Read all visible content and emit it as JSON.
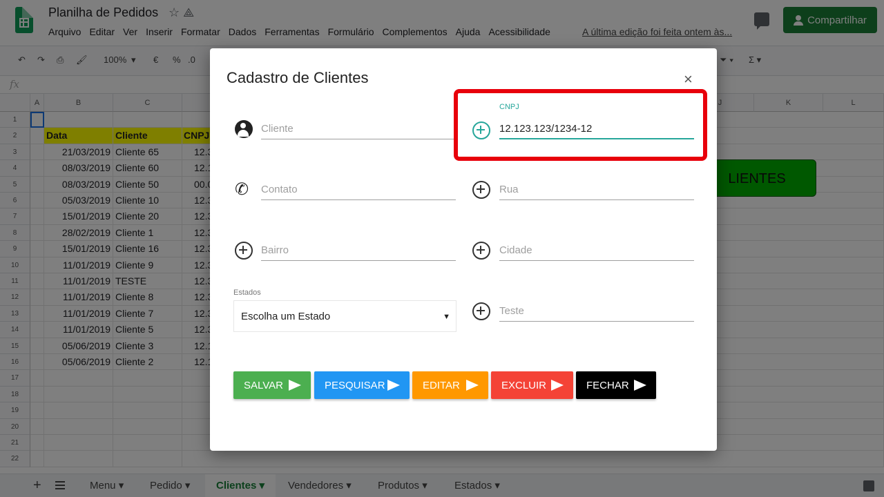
{
  "app": {
    "doc_title": "Planilha de Pedidos",
    "menu": [
      "Arquivo",
      "Editar",
      "Ver",
      "Inserir",
      "Formatar",
      "Dados",
      "Ferramentas",
      "Formulário",
      "Complementos",
      "Ajuda",
      "Acessibilidade"
    ],
    "last_edit": "A última edição foi feita ontem às...",
    "share_label": "Compartilhar",
    "zoom": "100%",
    "currency": "€",
    "percent": "%",
    "decimal": ".0",
    "fx": "fx"
  },
  "sheet": {
    "columns": [
      "A",
      "B",
      "C",
      "J",
      "K",
      "L"
    ],
    "rows": [
      "1",
      "2",
      "3",
      "4",
      "5",
      "6",
      "7",
      "8",
      "9",
      "10",
      "11",
      "12",
      "13",
      "14",
      "15",
      "16",
      "17",
      "18",
      "19",
      "20",
      "21",
      "22"
    ],
    "headers": [
      "Data",
      "Cliente",
      "CNPJ"
    ],
    "data": [
      [
        "21/03/2019",
        "Cliente 65",
        "12.3"
      ],
      [
        "08/03/2019",
        "Cliente 60",
        "12.1"
      ],
      [
        "08/03/2019",
        "Cliente 50",
        "00.0"
      ],
      [
        "05/03/2019",
        "Cliente 10",
        "12.3"
      ],
      [
        "15/01/2019",
        "Cliente 20",
        "12.3"
      ],
      [
        "28/02/2019",
        "Cliente 1",
        "12.3"
      ],
      [
        "15/01/2019",
        "Cliente 16",
        "12.3"
      ],
      [
        "11/01/2019",
        "Cliente 9",
        "12.3"
      ],
      [
        "11/01/2019",
        "TESTE",
        "12.3"
      ],
      [
        "11/01/2019",
        "Cliente 8",
        "12.3"
      ],
      [
        "11/01/2019",
        "Cliente 7",
        "12.3"
      ],
      [
        "11/01/2019",
        "Cliente 5",
        "12.3"
      ],
      [
        "05/06/2019",
        "Cliente 3",
        "12.1"
      ],
      [
        "05/06/2019",
        "Cliente 2",
        "12.1"
      ]
    ],
    "green_button": "LIENTES",
    "tabs": [
      "Menu",
      "Pedido",
      "Clientes",
      "Vendedores",
      "Produtos",
      "Estados"
    ],
    "active_tab": "Clientes"
  },
  "modal": {
    "title": "Cadastro de Clientes",
    "close": "×",
    "fields": {
      "cliente": {
        "placeholder": "Cliente",
        "value": ""
      },
      "cnpj": {
        "label": "CNPJ",
        "value": "12.123.123/1234-12"
      },
      "contato": {
        "placeholder": "Contato",
        "value": ""
      },
      "rua": {
        "placeholder": "Rua",
        "value": ""
      },
      "bairro": {
        "placeholder": "Bairro",
        "value": ""
      },
      "cidade": {
        "placeholder": "Cidade",
        "value": ""
      },
      "teste": {
        "placeholder": "Teste",
        "value": ""
      }
    },
    "estados": {
      "label": "Estados",
      "selected": "Escolha um Estado"
    },
    "buttons": [
      {
        "label": "SALVAR",
        "color": "#4caf50"
      },
      {
        "label": "PESQUISAR",
        "color": "#2196f3"
      },
      {
        "label": "EDITAR",
        "color": "#ff9800"
      },
      {
        "label": "EXCLUIR",
        "color": "#f44336"
      },
      {
        "label": "FECHAR",
        "color": "#000000"
      }
    ]
  },
  "colors": {
    "accent": "#26a69a",
    "highlight": "#e8000b",
    "share": "#1a7f37"
  }
}
